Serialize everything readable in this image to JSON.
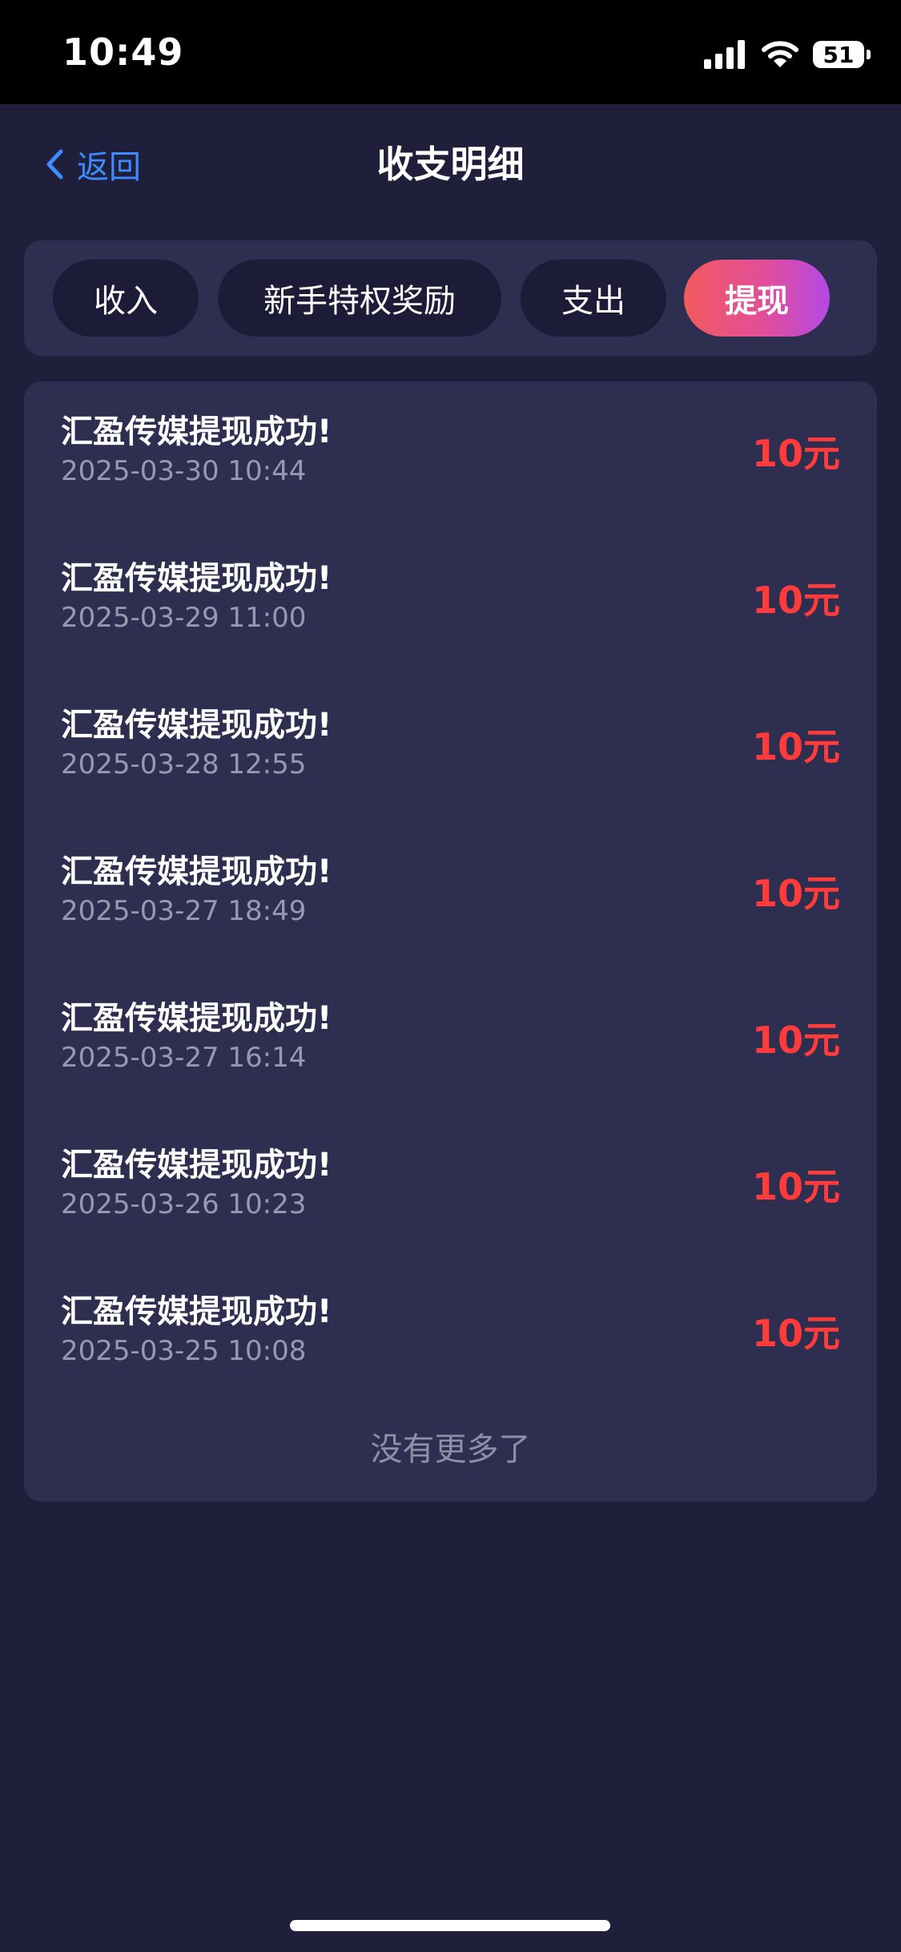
{
  "status_bar": {
    "time": "10:49",
    "battery": "51",
    "icons": [
      "signal-icon",
      "wifi-icon",
      "battery-icon"
    ]
  },
  "nav": {
    "back_label": "返回",
    "title": "收支明细",
    "icons": [
      "chevron-left-icon"
    ]
  },
  "tabs": [
    {
      "label": "收入",
      "active": false
    },
    {
      "label": "新手特权奖励",
      "active": false
    },
    {
      "label": "支出",
      "active": false
    },
    {
      "label": "提现",
      "active": true
    }
  ],
  "records": [
    {
      "title": "汇盈传媒提现成功!",
      "time": "2025-03-30 10:44",
      "amount": "10元"
    },
    {
      "title": "汇盈传媒提现成功!",
      "time": "2025-03-29 11:00",
      "amount": "10元"
    },
    {
      "title": "汇盈传媒提现成功!",
      "time": "2025-03-28 12:55",
      "amount": "10元"
    },
    {
      "title": "汇盈传媒提现成功!",
      "time": "2025-03-27 18:49",
      "amount": "10元"
    },
    {
      "title": "汇盈传媒提现成功!",
      "time": "2025-03-27 16:14",
      "amount": "10元"
    },
    {
      "title": "汇盈传媒提现成功!",
      "time": "2025-03-26 10:23",
      "amount": "10元"
    },
    {
      "title": "汇盈传媒提现成功!",
      "time": "2025-03-25 10:08",
      "amount": "10元"
    }
  ],
  "list_end": "没有更多了",
  "colors": {
    "background": "#1f1f3c",
    "panel": "#2e2f50",
    "tab_inactive": "#1c1c38",
    "accent_blue": "#3d8bff",
    "amount_red": "#ff3b3b",
    "secondary_text": "#9898b0"
  }
}
